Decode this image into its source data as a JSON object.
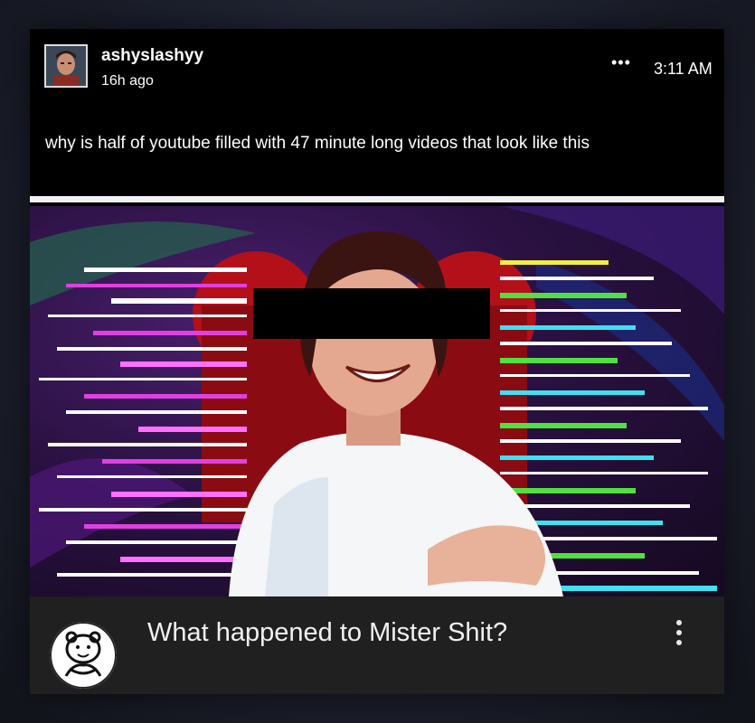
{
  "post": {
    "username": "ashyslashyy",
    "time_ago": "16h ago",
    "clock": "3:11 AM",
    "more_icon": "ellipsis-icon",
    "text": "why is half of youtube filled with 47 minute long videos that look like this"
  },
  "video": {
    "title": "What happened to Mister Shit?",
    "menu_icon": "vertical-ellipsis-icon",
    "channel_icon": "cartoon-mascot-icon"
  },
  "colors": {
    "post_background": "#000000",
    "video_bar": "#202020",
    "glitch_magenta": "#e040e0",
    "glitch_green": "#50e040",
    "glitch_cyan": "#40e0f0",
    "thumb_purple": "#2a1142"
  }
}
